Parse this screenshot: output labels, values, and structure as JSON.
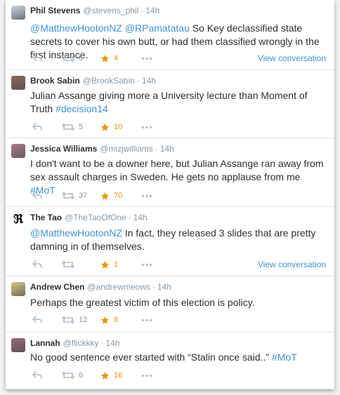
{
  "tweets": [
    {
      "name": "Phil Stevens",
      "handle": "@stevens_phil",
      "time": "14h",
      "segments": [
        {
          "text": "@MatthewHootonNZ",
          "link": true
        },
        {
          "text": " ",
          "link": false
        },
        {
          "text": "@RPamatatau",
          "link": true
        },
        {
          "text": " So Key declassified state secrets to cover his own butt, or had them classified wrongly in the first instance.",
          "link": false
        }
      ],
      "retweets": "6",
      "favorites": "4",
      "view_conversation": "View conversation"
    },
    {
      "name": "Brook Sabin",
      "handle": "@BrookSabin",
      "time": "14h",
      "segments": [
        {
          "text": "Julian Assange giving more a University lecture than Moment of Truth ",
          "link": false
        },
        {
          "text": "#decision14",
          "link": true
        }
      ],
      "retweets": "5",
      "favorites": "10",
      "view_conversation": ""
    },
    {
      "name": "Jessica Williams",
      "handle": "@mizjwilliams",
      "time": "14h",
      "segments": [
        {
          "text": "I don't want to be a downer here, but Julian Assange ran away from sex assault charges in Sweden. He gets no applause from me ",
          "link": false
        },
        {
          "text": "#MoT",
          "link": true
        }
      ],
      "retweets": "37",
      "favorites": "70",
      "view_conversation": ""
    },
    {
      "name": "The Tao",
      "handle": "@TheTaoOfOne",
      "time": "14h",
      "segments": [
        {
          "text": "@MatthewHootonNZ",
          "link": true
        },
        {
          "text": " In fact, they released 3 slides that are pretty damning in of themselves.",
          "link": false
        }
      ],
      "retweets": "",
      "favorites": "1",
      "view_conversation": "View conversation"
    },
    {
      "name": "Andrew Chen",
      "handle": "@andrewmeows",
      "time": "14h",
      "segments": [
        {
          "text": "Perhaps the greatest victim of this election is policy.",
          "link": false
        }
      ],
      "retweets": "12",
      "favorites": "8",
      "view_conversation": ""
    },
    {
      "name": "Lannah",
      "handle": "@flickkky",
      "time": "14h",
      "segments": [
        {
          "text": "No good sentence ever started with “Stalin once said..” ",
          "link": false
        },
        {
          "text": "#MoT",
          "link": true
        }
      ],
      "retweets": "6",
      "favorites": "16",
      "view_conversation": ""
    }
  ],
  "icons": {
    "reply": "reply-icon",
    "retweet": "retweet-icon",
    "favorite": "star-icon",
    "more": "more-icon"
  },
  "colors": {
    "link": "#3b94d9",
    "favorite": "#e6960f",
    "muted": "#8899a6",
    "text": "#292f33"
  }
}
